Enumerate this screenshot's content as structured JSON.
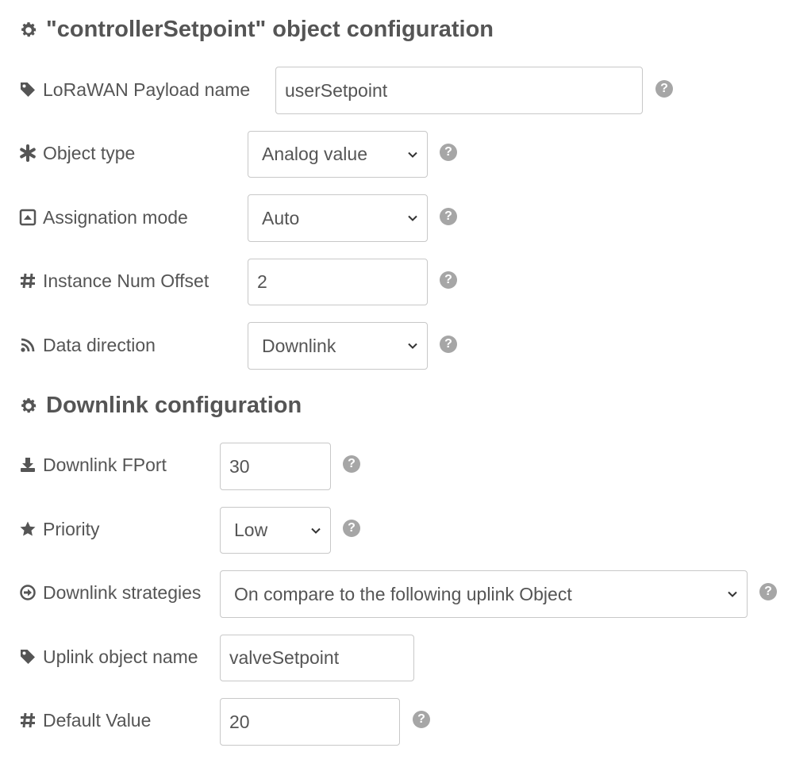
{
  "object_section": {
    "title": "\"controllerSetpoint\" object configuration",
    "icon": "gear-icon"
  },
  "payload_name": {
    "label": "LoRaWAN Payload name",
    "icon": "tag-icon",
    "value": "userSetpoint"
  },
  "object_type": {
    "label": "Object type",
    "icon": "asterisk-icon",
    "selected": "Analog value"
  },
  "assignation_mode": {
    "label": "Assignation mode",
    "icon": "caret-square-up-icon",
    "selected": "Auto"
  },
  "instance_offset": {
    "label": "Instance Num Offset",
    "icon": "hash-icon",
    "value": "2"
  },
  "data_direction": {
    "label": "Data direction",
    "icon": "rss-icon",
    "selected": "Downlink"
  },
  "downlink_section": {
    "title": "Downlink configuration",
    "icon": "gear-icon"
  },
  "downlink_fport": {
    "label": "Downlink FPort",
    "icon": "download-icon",
    "value": "30"
  },
  "priority": {
    "label": "Priority",
    "icon": "star-icon",
    "selected": "Low"
  },
  "downlink_strategies": {
    "label": "Downlink strategies",
    "icon": "arrow-circle-right-icon",
    "selected": "On compare to the following uplink Object"
  },
  "uplink_object_name": {
    "label": "Uplink object name",
    "icon": "tag-icon",
    "value": "valveSetpoint"
  },
  "default_value": {
    "label": "Default Value",
    "icon": "hash-icon",
    "value": "20"
  },
  "help_glyph": "?",
  "colors": {
    "text": "#555555",
    "border": "#c8c8c8",
    "help": "#a6a6a6"
  }
}
